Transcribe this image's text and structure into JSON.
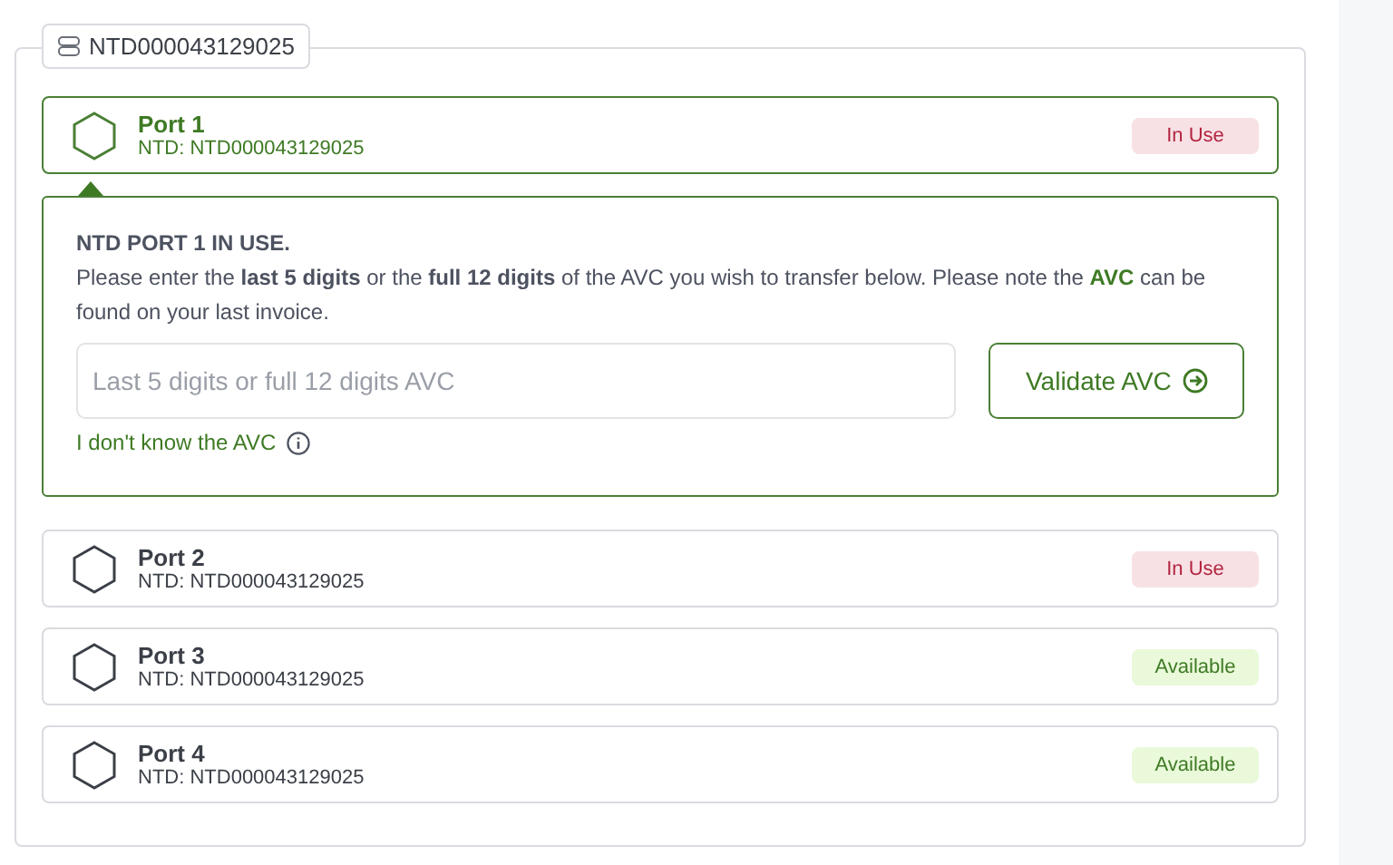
{
  "group": {
    "label": "NTD000043129025"
  },
  "ports": [
    {
      "name": "Port 1",
      "ntd": "NTD: NTD000043129025",
      "status": "In Use",
      "kind": "in_use",
      "selected": true
    },
    {
      "name": "Port 2",
      "ntd": "NTD: NTD000043129025",
      "status": "In Use",
      "kind": "in_use",
      "selected": false
    },
    {
      "name": "Port 3",
      "ntd": "NTD: NTD000043129025",
      "status": "Available",
      "kind": "available",
      "selected": false
    },
    {
      "name": "Port 4",
      "ntd": "NTD: NTD000043129025",
      "status": "Available",
      "kind": "available",
      "selected": false
    }
  ],
  "detail": {
    "heading": "NTD PORT 1 IN USE.",
    "text": "Please enter the **last 5 digits** or the **full 12 digits** of the AVC you wish to transfer below. Please note the **AVC** can be found on your last invoice.",
    "placeholder": "Last 5 digits or full 12 digits AVC",
    "button": "Validate AVC",
    "help_link": "I don't know the AVC"
  }
}
